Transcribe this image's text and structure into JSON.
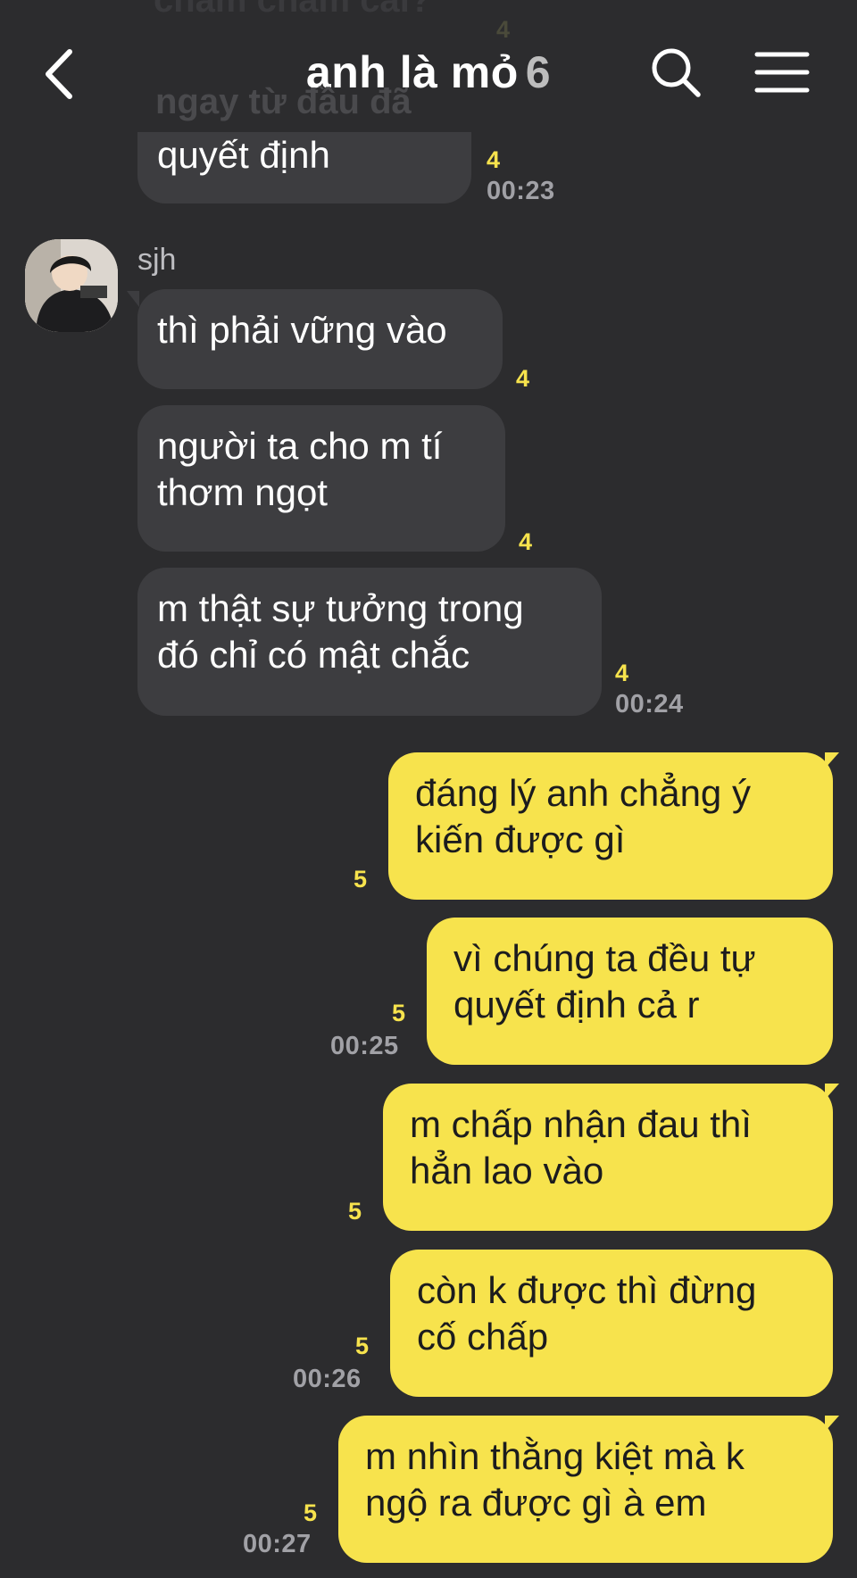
{
  "header": {
    "title": "anh là mỏ",
    "member_count": "6"
  },
  "ghost": {
    "line1": "chăm chăm cái?",
    "line2": "ngay từ đầu đã",
    "count": "4"
  },
  "messages": [
    {
      "text": "quyết định",
      "unread": "4",
      "time": "00:23"
    },
    {
      "sender": "sjh",
      "text": "thì phải vững vào",
      "unread": "4"
    },
    {
      "text": "người ta cho m tí\nthơm ngọt",
      "unread": "4"
    },
    {
      "text": "m thật sự tưởng trong\nđó chỉ có mật chắc",
      "unread": "4",
      "time": "00:24"
    },
    {
      "text": "đáng lý anh chẳng ý\nkiến được gì",
      "unread": "5"
    },
    {
      "text": "vì chúng ta đều tự\nquyết định cả r",
      "unread": "5",
      "time": "00:25"
    },
    {
      "text": "m chấp nhận đau thì\nhẳn lao vào",
      "unread": "5"
    },
    {
      "text": "còn k được thì đừng\ncố chấp",
      "unread": "5",
      "time": "00:26"
    },
    {
      "text": "m nhìn thằng kiệt mà k\nngộ ra được gì à em",
      "unread": "5",
      "time": "00:27"
    }
  ],
  "icons": {
    "back": "chevron-left-icon",
    "search": "search-icon",
    "menu": "hamburger-menu-icon"
  },
  "colors": {
    "background": "#2c2c2e",
    "incoming_bubble": "#3d3d40",
    "outgoing_bubble": "#f7e34d",
    "unread_count": "#f7e34d",
    "timestamp": "#a1a1a6"
  }
}
